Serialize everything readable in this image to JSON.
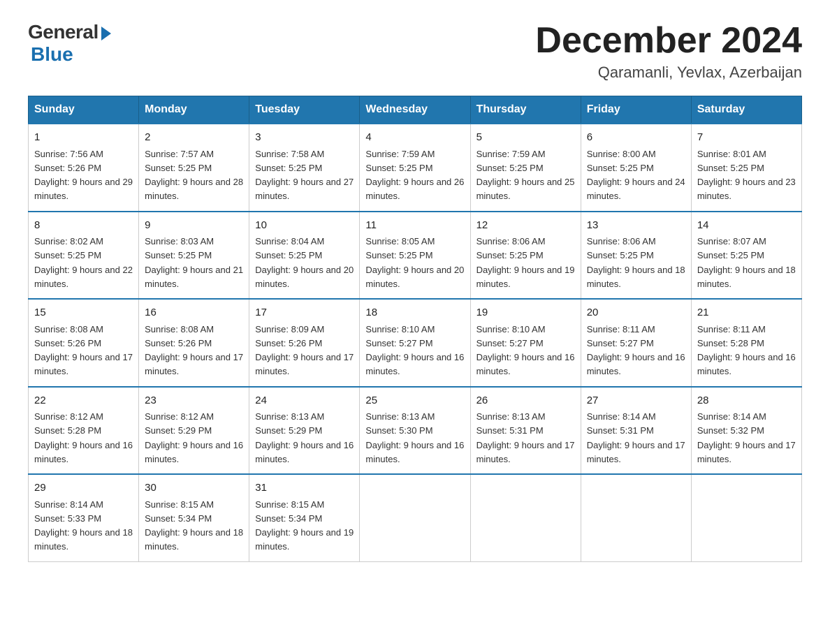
{
  "header": {
    "logo_general": "General",
    "logo_blue": "Blue",
    "month_title": "December 2024",
    "location": "Qaramanli, Yevlax, Azerbaijan"
  },
  "columns": [
    "Sunday",
    "Monday",
    "Tuesday",
    "Wednesday",
    "Thursday",
    "Friday",
    "Saturday"
  ],
  "weeks": [
    [
      {
        "day": "1",
        "sunrise": "7:56 AM",
        "sunset": "5:26 PM",
        "daylight": "9 hours and 29 minutes."
      },
      {
        "day": "2",
        "sunrise": "7:57 AM",
        "sunset": "5:25 PM",
        "daylight": "9 hours and 28 minutes."
      },
      {
        "day": "3",
        "sunrise": "7:58 AM",
        "sunset": "5:25 PM",
        "daylight": "9 hours and 27 minutes."
      },
      {
        "day": "4",
        "sunrise": "7:59 AM",
        "sunset": "5:25 PM",
        "daylight": "9 hours and 26 minutes."
      },
      {
        "day": "5",
        "sunrise": "7:59 AM",
        "sunset": "5:25 PM",
        "daylight": "9 hours and 25 minutes."
      },
      {
        "day": "6",
        "sunrise": "8:00 AM",
        "sunset": "5:25 PM",
        "daylight": "9 hours and 24 minutes."
      },
      {
        "day": "7",
        "sunrise": "8:01 AM",
        "sunset": "5:25 PM",
        "daylight": "9 hours and 23 minutes."
      }
    ],
    [
      {
        "day": "8",
        "sunrise": "8:02 AM",
        "sunset": "5:25 PM",
        "daylight": "9 hours and 22 minutes."
      },
      {
        "day": "9",
        "sunrise": "8:03 AM",
        "sunset": "5:25 PM",
        "daylight": "9 hours and 21 minutes."
      },
      {
        "day": "10",
        "sunrise": "8:04 AM",
        "sunset": "5:25 PM",
        "daylight": "9 hours and 20 minutes."
      },
      {
        "day": "11",
        "sunrise": "8:05 AM",
        "sunset": "5:25 PM",
        "daylight": "9 hours and 20 minutes."
      },
      {
        "day": "12",
        "sunrise": "8:06 AM",
        "sunset": "5:25 PM",
        "daylight": "9 hours and 19 minutes."
      },
      {
        "day": "13",
        "sunrise": "8:06 AM",
        "sunset": "5:25 PM",
        "daylight": "9 hours and 18 minutes."
      },
      {
        "day": "14",
        "sunrise": "8:07 AM",
        "sunset": "5:25 PM",
        "daylight": "9 hours and 18 minutes."
      }
    ],
    [
      {
        "day": "15",
        "sunrise": "8:08 AM",
        "sunset": "5:26 PM",
        "daylight": "9 hours and 17 minutes."
      },
      {
        "day": "16",
        "sunrise": "8:08 AM",
        "sunset": "5:26 PM",
        "daylight": "9 hours and 17 minutes."
      },
      {
        "day": "17",
        "sunrise": "8:09 AM",
        "sunset": "5:26 PM",
        "daylight": "9 hours and 17 minutes."
      },
      {
        "day": "18",
        "sunrise": "8:10 AM",
        "sunset": "5:27 PM",
        "daylight": "9 hours and 16 minutes."
      },
      {
        "day": "19",
        "sunrise": "8:10 AM",
        "sunset": "5:27 PM",
        "daylight": "9 hours and 16 minutes."
      },
      {
        "day": "20",
        "sunrise": "8:11 AM",
        "sunset": "5:27 PM",
        "daylight": "9 hours and 16 minutes."
      },
      {
        "day": "21",
        "sunrise": "8:11 AM",
        "sunset": "5:28 PM",
        "daylight": "9 hours and 16 minutes."
      }
    ],
    [
      {
        "day": "22",
        "sunrise": "8:12 AM",
        "sunset": "5:28 PM",
        "daylight": "9 hours and 16 minutes."
      },
      {
        "day": "23",
        "sunrise": "8:12 AM",
        "sunset": "5:29 PM",
        "daylight": "9 hours and 16 minutes."
      },
      {
        "day": "24",
        "sunrise": "8:13 AM",
        "sunset": "5:29 PM",
        "daylight": "9 hours and 16 minutes."
      },
      {
        "day": "25",
        "sunrise": "8:13 AM",
        "sunset": "5:30 PM",
        "daylight": "9 hours and 16 minutes."
      },
      {
        "day": "26",
        "sunrise": "8:13 AM",
        "sunset": "5:31 PM",
        "daylight": "9 hours and 17 minutes."
      },
      {
        "day": "27",
        "sunrise": "8:14 AM",
        "sunset": "5:31 PM",
        "daylight": "9 hours and 17 minutes."
      },
      {
        "day": "28",
        "sunrise": "8:14 AM",
        "sunset": "5:32 PM",
        "daylight": "9 hours and 17 minutes."
      }
    ],
    [
      {
        "day": "29",
        "sunrise": "8:14 AM",
        "sunset": "5:33 PM",
        "daylight": "9 hours and 18 minutes."
      },
      {
        "day": "30",
        "sunrise": "8:15 AM",
        "sunset": "5:34 PM",
        "daylight": "9 hours and 18 minutes."
      },
      {
        "day": "31",
        "sunrise": "8:15 AM",
        "sunset": "5:34 PM",
        "daylight": "9 hours and 19 minutes."
      },
      null,
      null,
      null,
      null
    ]
  ]
}
